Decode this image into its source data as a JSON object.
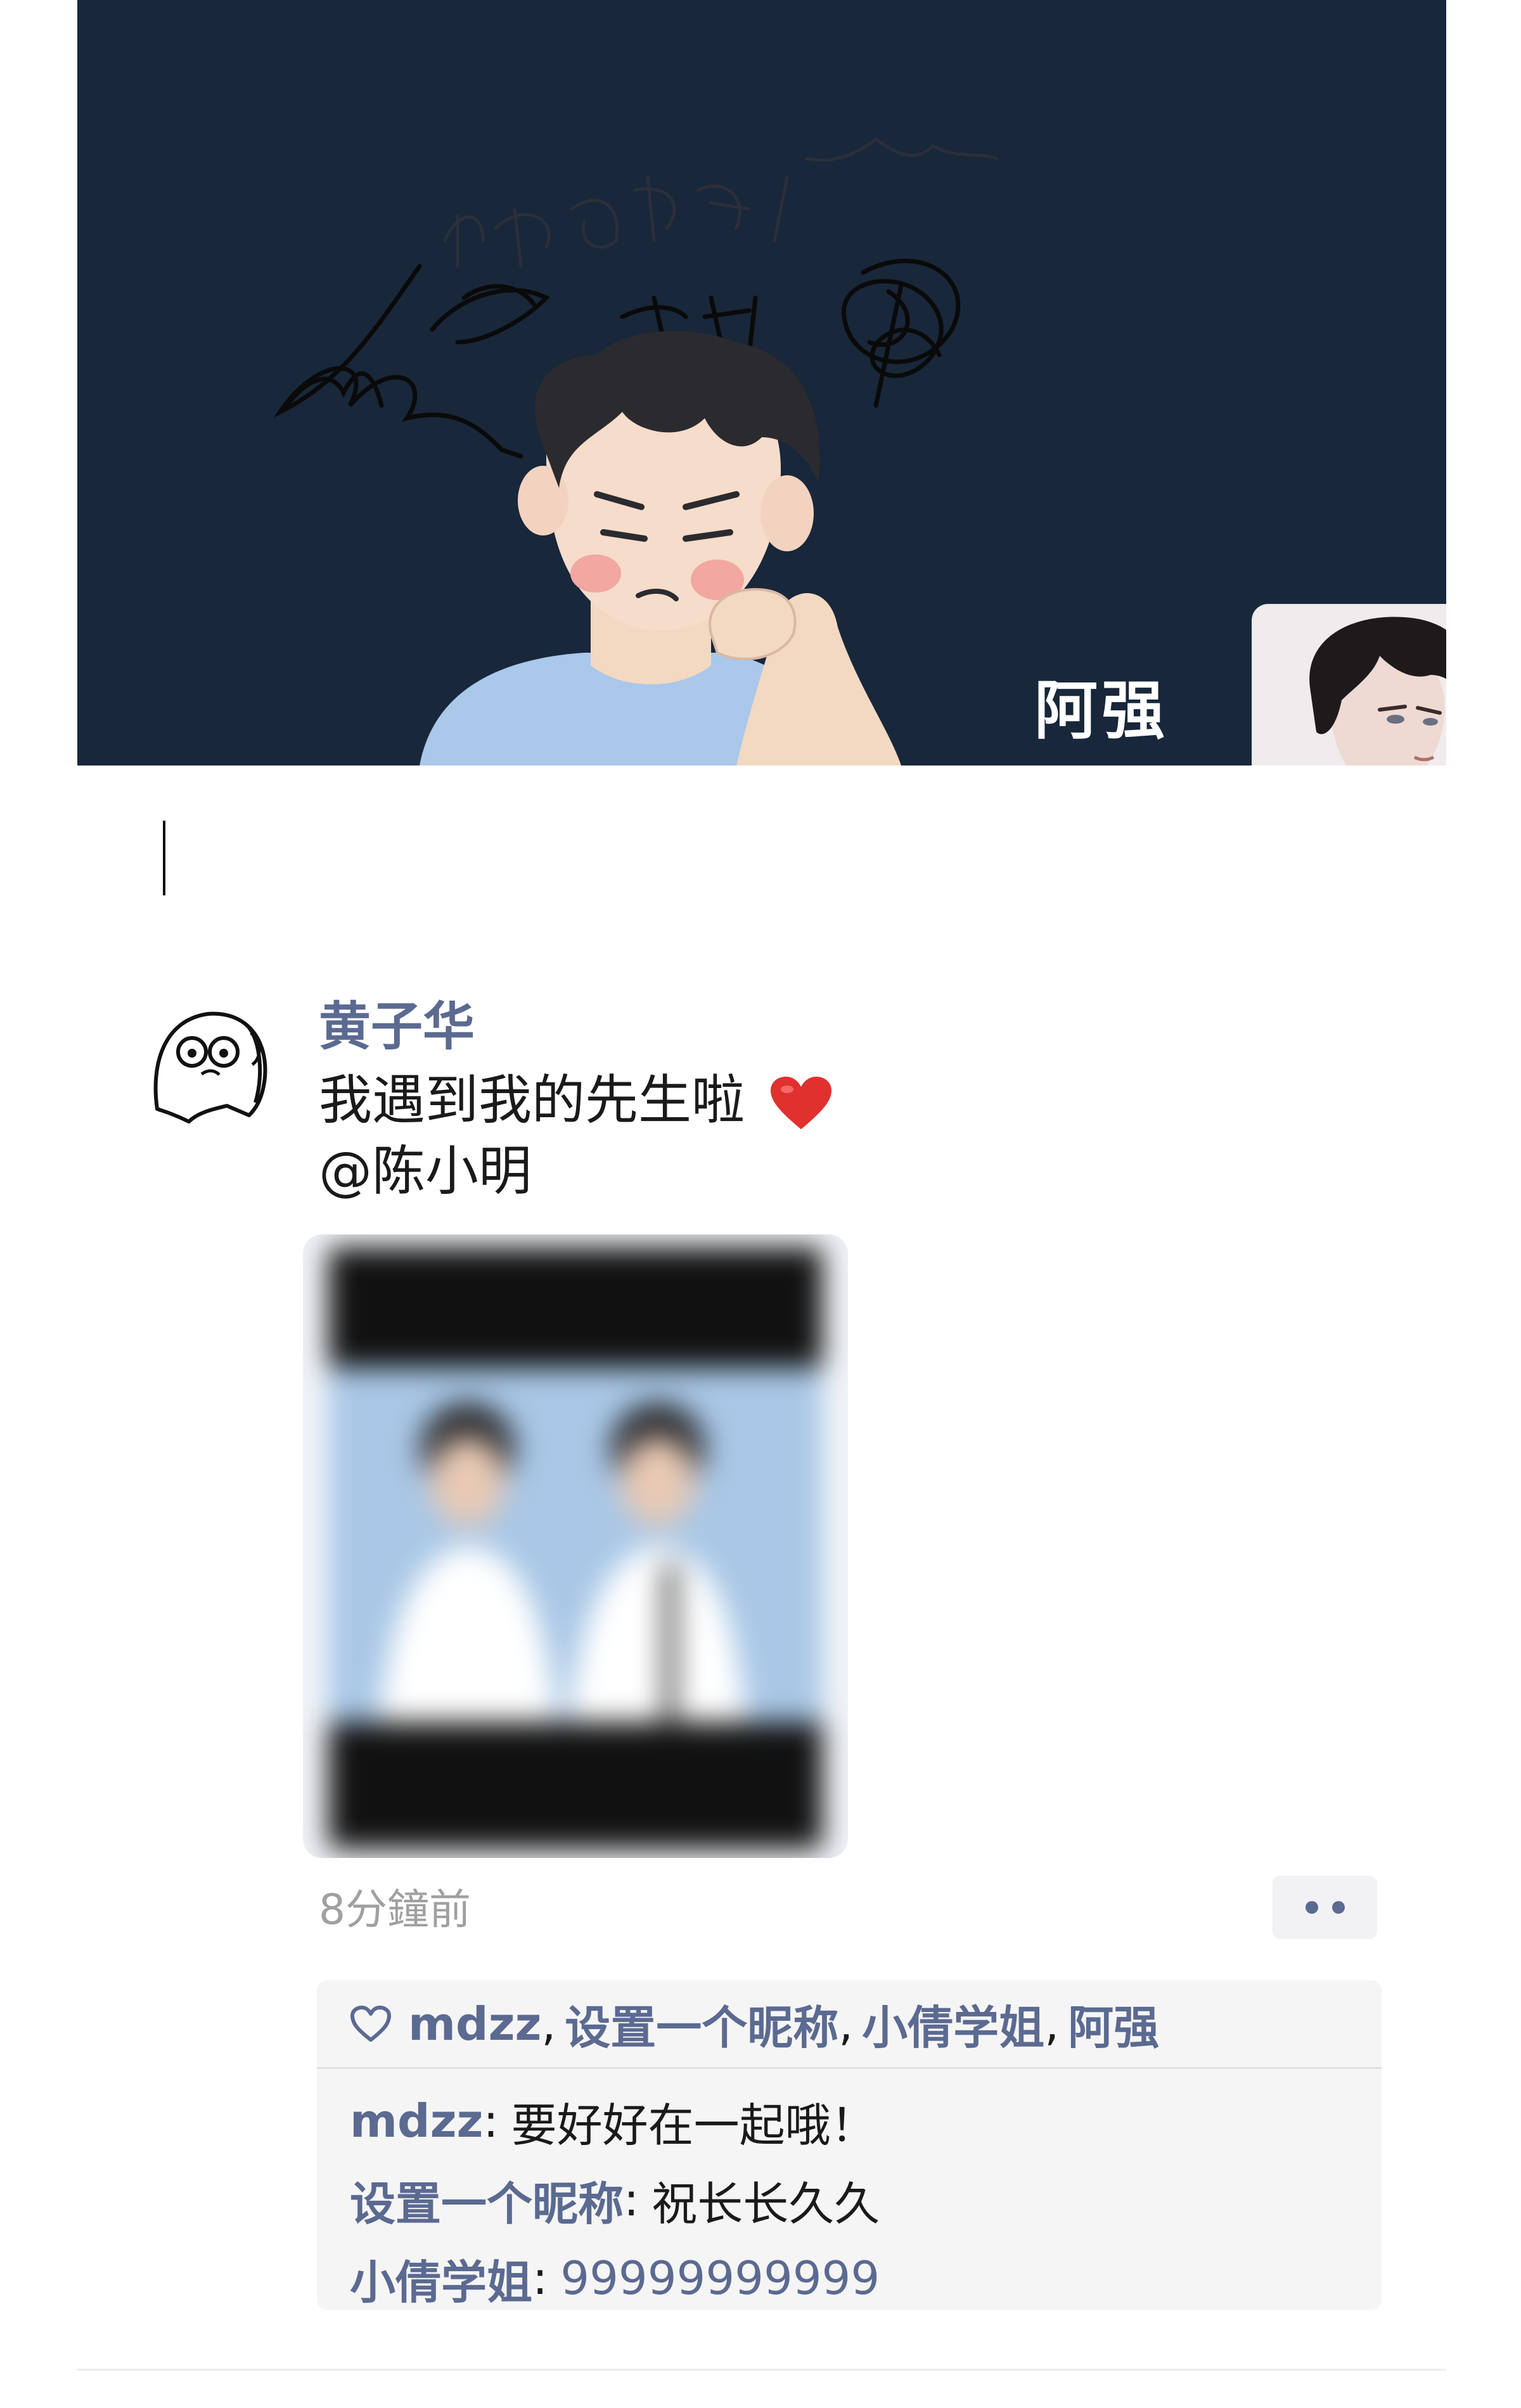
{
  "cover": {
    "owner_name": "阿强",
    "doodle_text": "同性恋是病"
  },
  "post": {
    "author": "黄子华",
    "text": "我遇到我的先生啦",
    "mention": "@陈小明",
    "timestamp": "8分鐘前",
    "more_icon": "more-dots-icon"
  },
  "likes": {
    "icon": "heart-outline-icon",
    "names": [
      "mdzz",
      "设置一个昵称",
      "小倩学姐",
      "阿强"
    ]
  },
  "comments": [
    {
      "name": "mdzz",
      "text": "要好好在一起哦！"
    },
    {
      "name": "设置一个昵称",
      "text": "祝长长久久"
    },
    {
      "name": "小倩学姐",
      "text": "99999999999"
    }
  ],
  "colors": {
    "link_blue": "#5b6a91",
    "cover_bg": "#18273a",
    "panel_bg": "#f5f5f5",
    "timestamp_gray": "#a0a0a0",
    "heart_red": "#e0312f"
  }
}
